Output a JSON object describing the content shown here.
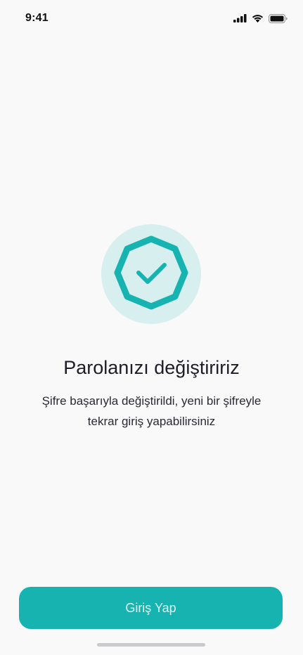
{
  "status_bar": {
    "time": "9:41",
    "icons": [
      "signal-icon",
      "wifi-icon",
      "battery-icon"
    ]
  },
  "success": {
    "icon": "check-badge-icon",
    "title": "Parolanızı değiştiririz",
    "message": "Şifre başarıyla değiştirildi, yeni bir şifreyle tekrar giriş yapabilirsiniz"
  },
  "actions": {
    "login_label": "Giriş Yap"
  },
  "colors": {
    "accent": "#17b3b0",
    "badge_bg": "#d7efef",
    "background": "#f9f9fa"
  }
}
